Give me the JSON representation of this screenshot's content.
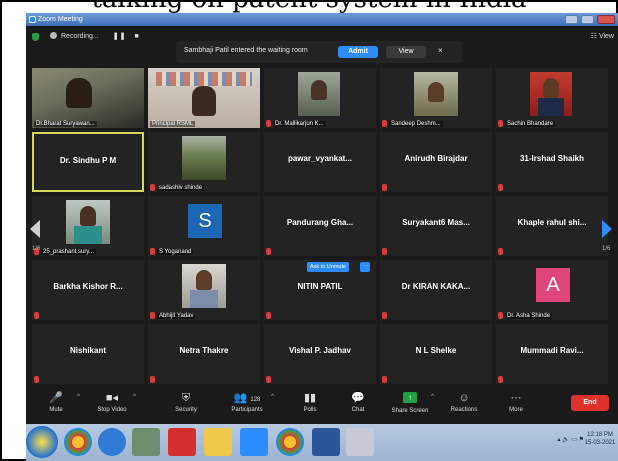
{
  "page_caption": "talking on patent system in India",
  "window": {
    "title": "Zoom Meeting"
  },
  "recording": {
    "label": "Recording...",
    "pause": "❚❚",
    "stop": "■"
  },
  "view_label": "☷ View",
  "notification": {
    "message": "Sambhaji  Patil entered the waiting room",
    "admit": "Admit",
    "view": "View",
    "close": "×"
  },
  "participants": {
    "r1": [
      "Dr.Bharat Suryawan...",
      "Principal RSML",
      "Dr. Mallikarjun K...",
      "Sandeep Deshm...",
      "Sachin Bhandare"
    ],
    "r2": [
      "Dr. Sindhu P M",
      "sadashiv shinde",
      "pawar_vyankat...",
      "Anirudh Birajdar",
      "31-Irshad Shaikh"
    ],
    "r3": [
      "25_prashant sury...",
      "S Yoganand",
      "Pandurang Gha...",
      "Suryakant6 Mas...",
      "Khaple rahul shi..."
    ],
    "r4": [
      "Barkha Kishor R...",
      "Abhijit Yadav",
      "NITIN PATIL",
      "Dr KIRAN KAKA...",
      "Dr. Asha Shinde"
    ],
    "r5": [
      "Nishikant",
      "Netra Thakre",
      "Vishal P. Jadhav",
      "N L Shelke",
      "Mummadi Ravi..."
    ]
  },
  "avatars": {
    "yoganand": "S",
    "asha": "A"
  },
  "ask_to_unmute": "Ask to Unmute",
  "more_dots": "···",
  "page_left": "1/6",
  "page_right": "1/6",
  "toolbar": {
    "mute": "Mute",
    "stop_video": "Stop Video",
    "security": "Security",
    "participants": "Participants",
    "participants_count": "128",
    "polls": "Polls",
    "chat": "Chat",
    "share_screen": "Share Screen",
    "reactions": "Reactions",
    "more": "More",
    "end": "End"
  },
  "clock": {
    "time": "12:18 PM",
    "date": "15-03-2021"
  },
  "colors": {
    "accent": "#2d8cff",
    "end": "#e0302a",
    "selected_border": "#d3d85c",
    "muted": "#d93b3b"
  }
}
